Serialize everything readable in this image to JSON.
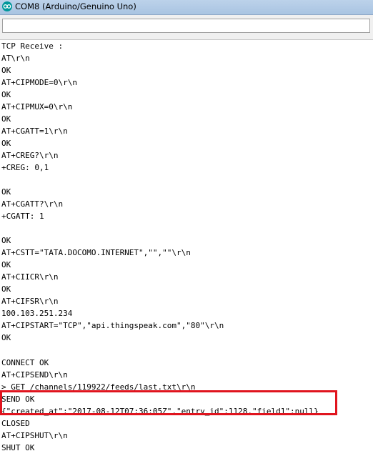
{
  "window": {
    "title": "COM8 (Arduino/Genuino Uno)",
    "app_icon": "arduino-icon",
    "accent_color": "#00979c"
  },
  "input": {
    "value": ""
  },
  "serial_output": [
    "TCP Receive :",
    "AT\\r\\n",
    "OK",
    "AT+CIPMODE=0\\r\\n",
    "OK",
    "AT+CIPMUX=0\\r\\n",
    "OK",
    "AT+CGATT=1\\r\\n",
    "OK",
    "AT+CREG?\\r\\n",
    "+CREG: 0,1",
    "",
    "OK",
    "AT+CGATT?\\r\\n",
    "+CGATT: 1",
    "",
    "OK",
    "AT+CSTT=\"TATA.DOCOMO.INTERNET\",\"\",\"\"\\r\\n",
    "OK",
    "AT+CIICR\\r\\n",
    "OK",
    "AT+CIFSR\\r\\n",
    "100.103.251.234",
    "AT+CIPSTART=\"TCP\",\"api.thingspeak.com\",\"80\"\\r\\n",
    "OK",
    "",
    "CONNECT OK",
    "AT+CIPSEND\\r\\n",
    "> GET /channels/119922/feeds/last.txt\\r\\n",
    "SEND OK",
    "{\"created_at\":\"2017-08-12T07:36:05Z\",\"entry_id\":1128,\"field1\":null}",
    "CLOSED",
    "AT+CIPSHUT\\r\\n",
    "SHUT OK"
  ],
  "highlight": {
    "color": "#e0141e"
  }
}
